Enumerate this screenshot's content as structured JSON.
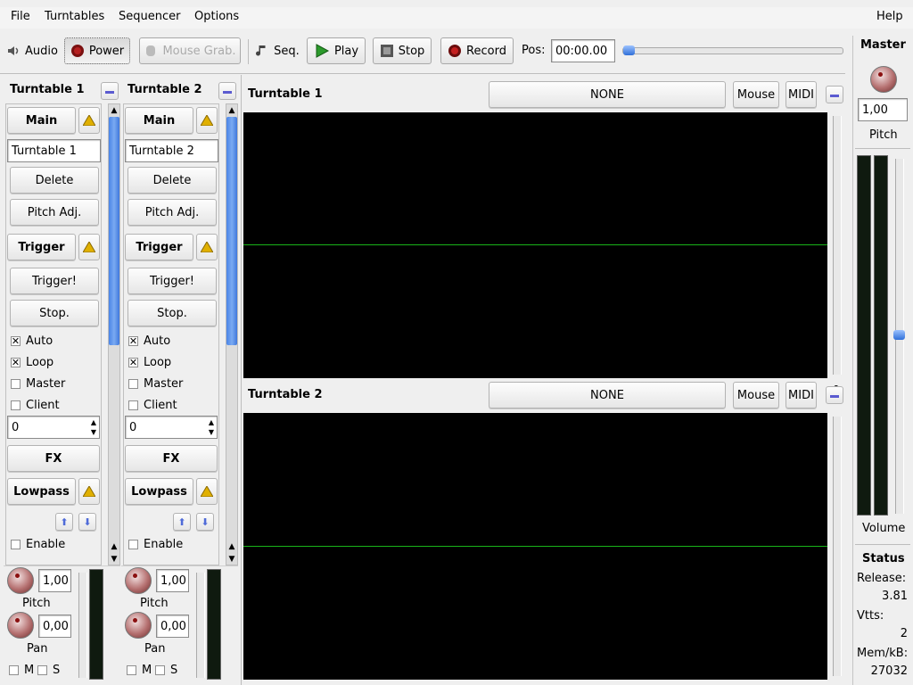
{
  "menu": {
    "file": "File",
    "turntables": "Turntables",
    "sequencer": "Sequencer",
    "options": "Options",
    "help": "Help"
  },
  "toolbar": {
    "audio": "Audio",
    "power": "Power",
    "mouse_grab": "Mouse Grab.",
    "seq": "Seq.",
    "play": "Play",
    "stop": "Stop",
    "record": "Record",
    "pos_label": "Pos:",
    "pos_value": "00:00.00",
    "position_fraction": 0.0
  },
  "turntables": [
    {
      "header": "Turntable 1",
      "main": "Main",
      "name": "Turntable 1",
      "delete": "Delete",
      "pitch_adj": "Pitch Adj.",
      "trigger_section": "Trigger",
      "trigger": "Trigger!",
      "stop": "Stop.",
      "auto": "Auto",
      "loop": "Loop",
      "master": "Master",
      "client": "Client",
      "spin": "0",
      "fx": "FX",
      "lowpass": "Lowpass",
      "enable": "Enable",
      "pitch_value": "1,00",
      "pitch_label": "Pitch",
      "pan_value": "0,00",
      "pan_label": "Pan",
      "m": "M",
      "s": "S"
    },
    {
      "header": "Turntable 2",
      "main": "Main",
      "name": "Turntable 2",
      "delete": "Delete",
      "pitch_adj": "Pitch Adj.",
      "trigger_section": "Trigger",
      "trigger": "Trigger!",
      "stop": "Stop.",
      "auto": "Auto",
      "loop": "Loop",
      "master": "Master",
      "client": "Client",
      "spin": "0",
      "fx": "FX",
      "lowpass": "Lowpass",
      "enable": "Enable",
      "pitch_value": "1,00",
      "pitch_label": "Pitch",
      "pan_value": "0,00",
      "pan_label": "Pan",
      "m": "M",
      "s": "S"
    }
  ],
  "displays": [
    {
      "title": "Turntable 1",
      "source": "NONE",
      "mouse": "Mouse",
      "midi": "MIDI",
      "value": "0"
    },
    {
      "title": "Turntable 2",
      "source": "NONE",
      "mouse": "Mouse",
      "midi": "MIDI",
      "value": "0"
    }
  ],
  "master": {
    "title": "Master",
    "pitch_value": "1,00",
    "pitch_label": "Pitch",
    "volume_label": "Volume"
  },
  "status": {
    "title": "Status",
    "release_label": "Release:",
    "release_value": "3.81",
    "vtts_label": "Vtts:",
    "vtts_value": "2",
    "mem_label": "Mem/kB:",
    "mem_value": "27032"
  },
  "icons": {
    "audio": "speaker-icon",
    "power": "power-icon",
    "mouse_grab": "mouse-icon",
    "seq": "music-note-icon",
    "play": "play-icon",
    "stop": "stop-icon",
    "record": "record-icon"
  }
}
